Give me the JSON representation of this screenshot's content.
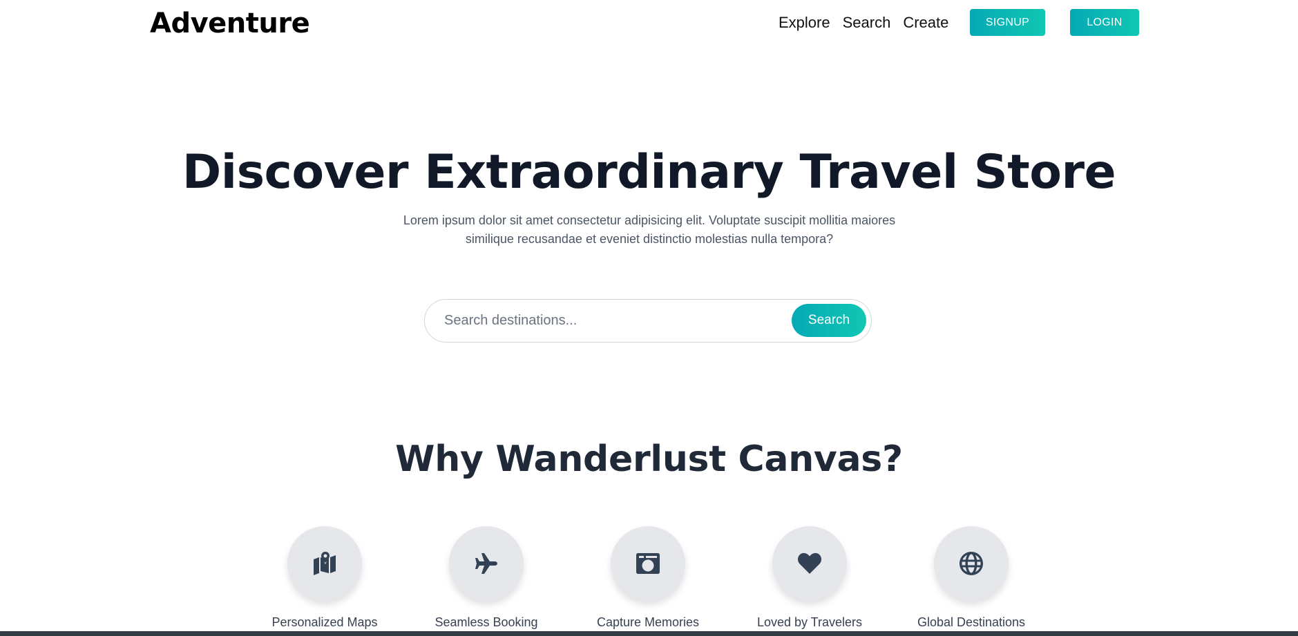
{
  "header": {
    "brand": "Adventure",
    "nav_links": [
      {
        "label": "Explore"
      },
      {
        "label": "Search"
      },
      {
        "label": "Create"
      }
    ],
    "signup_label": "SIGNUP",
    "login_label": "LOGIN"
  },
  "hero": {
    "title": "Discover Extraordinary Travel Store",
    "subtitle_line1": "Lorem ipsum dolor sit amet consectetur adipisicing elit. Voluptate suscipit mollitia maiores",
    "subtitle_line2": "similique recusandae et eveniet distinctio molestias nulla tempora?"
  },
  "search": {
    "placeholder": "Search destinations...",
    "value": "",
    "button_label": "Search"
  },
  "why": {
    "title": "Why Wanderlust Canvas?",
    "features": [
      {
        "icon": "map-location-icon",
        "label": "Personalized Maps"
      },
      {
        "icon": "airplane-icon",
        "label": "Seamless Booking"
      },
      {
        "icon": "camera-icon",
        "label": "Capture Memories"
      },
      {
        "icon": "heart-icon",
        "label": "Loved by Travelers"
      },
      {
        "icon": "globe-icon",
        "label": "Global Destinations"
      }
    ]
  },
  "colors": {
    "accent_start": "#06a9b4",
    "accent_end": "#10c7b3",
    "heading": "#111827",
    "icon_circle": "#e5e7eb",
    "icon_fill": "#334155"
  }
}
